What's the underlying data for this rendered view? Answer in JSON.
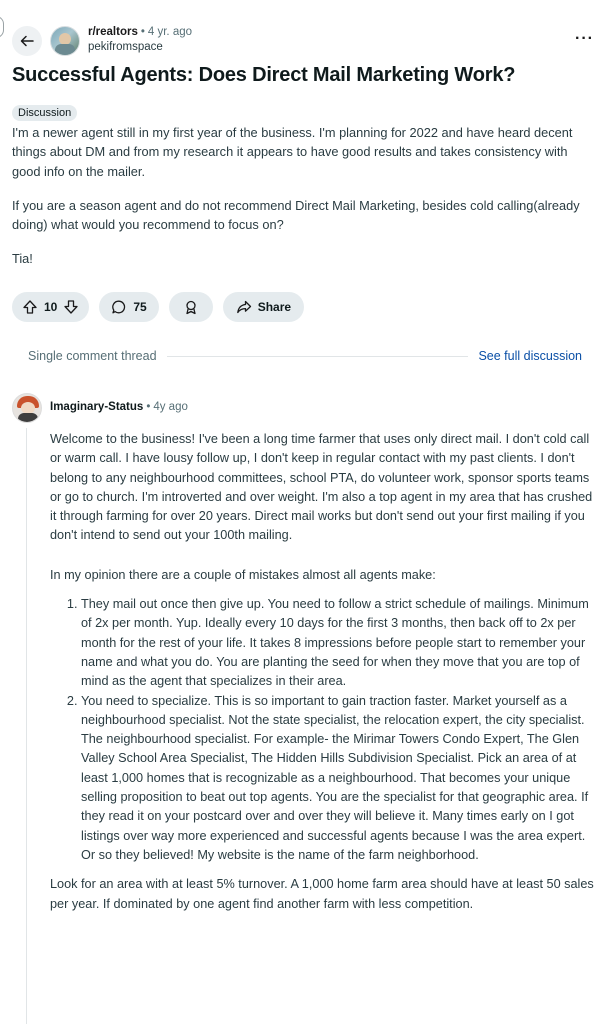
{
  "post": {
    "subreddit": "r/realtors",
    "age": "4 yr. ago",
    "author": "pekifromspace",
    "title": "Successful Agents: Does Direct Mail Marketing Work?",
    "flair": "Discussion",
    "paragraphs": [
      "I'm a newer agent still in my first year of the business. I'm planning for 2022 and have heard decent things about DM and from my research it appears to have good results and takes consistency with good info on the mailer.",
      "If you are a season agent and do not recommend Direct Mail Marketing, besides cold calling(already doing) what would you recommend to focus on?",
      "Tia!"
    ]
  },
  "actions": {
    "vote_count": "10",
    "comment_count": "75",
    "share_label": "Share"
  },
  "thread": {
    "label": "Single comment thread",
    "full_link": "See full discussion"
  },
  "comment": {
    "author": "Imaginary-Status",
    "age": "4y ago",
    "intro": "Welcome to the business! I've been a long time farmer that uses only direct mail. I don't cold call or warm call. I have lousy follow up, I don't keep in regular contact with my past clients. I don't belong to any neighbourhood committees, school PTA, do volunteer work, sponsor sports teams or go to church. I'm introverted and over weight. I'm also a top agent in my area that has crushed it through farming for over 20 years. Direct mail works but don't send out your first mailing if you don't intend to send out your 100th mailing.",
    "lead": "In my opinion there are a couple of mistakes almost all agents make:",
    "points": [
      "They mail out once then give up. You need to follow a strict schedule of mailings. Minimum of 2x per month. Yup. Ideally every 10 days for the first 3 months, then back off to 2x per month for the rest of your life. It takes 8 impressions before people start to remember your name and what you do. You are planting the seed for when they move that you are top of mind as the agent that specializes in their area.",
      "You need to specialize. This is so important to gain traction faster. Market yourself as a neighbourhood specialist. Not the state specialist, the relocation expert, the city specialist. The neighbourhood specialist. For example- the Mirimar Towers Condo Expert, The Glen Valley School Area Specialist, The Hidden Hills Subdivision Specialist. Pick an area of at least 1,000 homes that is recognizable as a neighbourhood. That becomes your unique selling proposition to beat out top agents. You are the specialist for that geographic area. If they read it on your postcard over and over they will believe it. Many times early on I got listings over way more experienced and successful agents because I was the area expert. Or so they believed! My website is the name of the farm neighborhood."
    ],
    "closing": "Look for an area with at least 5% turnover. A 1,000 home farm area should have at least 50 sales per year. If dominated by one agent find another farm with less competition."
  },
  "icons": {
    "back": "arrow-left-icon",
    "more": "ellipsis-icon",
    "upvote": "arrow-up-icon",
    "downvote": "arrow-down-icon",
    "comments": "speech-bubble-icon",
    "award": "award-icon",
    "share": "share-arrow-icon"
  },
  "colors": {
    "link": "#0a4fa6",
    "pill_bg": "#e5ebee",
    "muted_text": "#576f76"
  }
}
